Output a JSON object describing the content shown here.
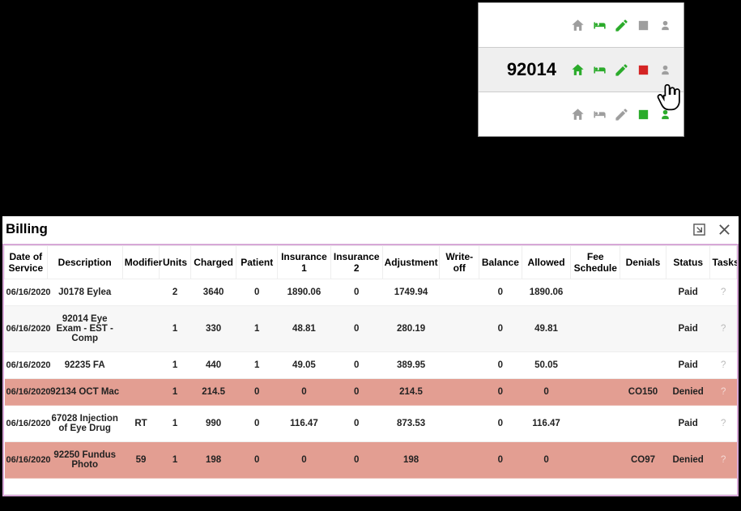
{
  "popup": {
    "rows": [
      {
        "code": ""
      },
      {
        "code": "92014",
        "highlight": true,
        "red_box": true
      },
      {
        "code": ""
      }
    ]
  },
  "billing": {
    "title": "Billing",
    "columns": [
      "Date of Service",
      "Description",
      "Modifier",
      "Units",
      "Charged",
      "Patient",
      "Insurance 1",
      "Insurance 2",
      "Adjustment",
      "Write-off",
      "Balance",
      "Allowed",
      "Fee Schedule",
      "Denials",
      "Status",
      "Tasks"
    ],
    "rows": [
      {
        "dos": "06/16/2020",
        "desc": "J0178 Eylea",
        "mod": "",
        "units": "2",
        "charged": "3640",
        "patient": "0",
        "ins1": "1890.06",
        "ins2": "0",
        "adj": "1749.94",
        "wo": "",
        "bal": "0",
        "allow": "1890.06",
        "fee": "",
        "den": "",
        "status": "Paid",
        "tasks": "?",
        "class": ""
      },
      {
        "dos": "06/16/2020",
        "desc": "92014 Eye Exam - EST - Comp",
        "mod": "",
        "units": "1",
        "charged": "330",
        "patient": "1",
        "ins1": "48.81",
        "ins2": "0",
        "adj": "280.19",
        "wo": "",
        "bal": "0",
        "allow": "49.81",
        "fee": "",
        "den": "",
        "status": "Paid",
        "tasks": "?",
        "class": "alt"
      },
      {
        "dos": "06/16/2020",
        "desc": "92235 FA",
        "mod": "",
        "units": "1",
        "charged": "440",
        "patient": "1",
        "ins1": "49.05",
        "ins2": "0",
        "adj": "389.95",
        "wo": "",
        "bal": "0",
        "allow": "50.05",
        "fee": "",
        "den": "",
        "status": "Paid",
        "tasks": "?",
        "class": ""
      },
      {
        "dos": "06/16/2020",
        "desc": "92134 OCT Mac",
        "mod": "",
        "units": "1",
        "charged": "214.5",
        "patient": "0",
        "ins1": "0",
        "ins2": "0",
        "adj": "214.5",
        "wo": "",
        "bal": "0",
        "allow": "0",
        "fee": "",
        "den": "CO150",
        "status": "Denied",
        "tasks": "?",
        "class": "denied"
      },
      {
        "dos": "06/16/2020",
        "desc": "67028 Injection of Eye Drug",
        "mod": "RT",
        "units": "1",
        "charged": "990",
        "patient": "0",
        "ins1": "116.47",
        "ins2": "0",
        "adj": "873.53",
        "wo": "",
        "bal": "0",
        "allow": "116.47",
        "fee": "",
        "den": "",
        "status": "Paid",
        "tasks": "?",
        "class": ""
      },
      {
        "dos": "06/16/2020",
        "desc": "92250 Fundus Photo",
        "mod": "59",
        "units": "1",
        "charged": "198",
        "patient": "0",
        "ins1": "0",
        "ins2": "0",
        "adj": "198",
        "wo": "",
        "bal": "0",
        "allow": "0",
        "fee": "",
        "den": "CO97",
        "status": "Denied",
        "tasks": "?",
        "class": "denied"
      }
    ]
  },
  "chart_data": {
    "type": "table",
    "title": "Billing",
    "columns": [
      "Date of Service",
      "Description",
      "Modifier",
      "Units",
      "Charged",
      "Patient",
      "Insurance 1",
      "Insurance 2",
      "Adjustment",
      "Write-off",
      "Balance",
      "Allowed",
      "Fee Schedule",
      "Denials",
      "Status"
    ],
    "rows": [
      [
        "06/16/2020",
        "J0178 Eylea",
        "",
        2,
        3640,
        0,
        1890.06,
        0,
        1749.94,
        null,
        0,
        1890.06,
        "",
        "",
        "Paid"
      ],
      [
        "06/16/2020",
        "92014 Eye Exam - EST - Comp",
        "",
        1,
        330,
        1,
        48.81,
        0,
        280.19,
        null,
        0,
        49.81,
        "",
        "",
        "Paid"
      ],
      [
        "06/16/2020",
        "92235 FA",
        "",
        1,
        440,
        1,
        49.05,
        0,
        389.95,
        null,
        0,
        50.05,
        "",
        "",
        "Paid"
      ],
      [
        "06/16/2020",
        "92134 OCT Mac",
        "",
        1,
        214.5,
        0,
        0,
        0,
        214.5,
        null,
        0,
        0,
        "",
        "CO150",
        "Denied"
      ],
      [
        "06/16/2020",
        "67028 Injection of Eye Drug",
        "RT",
        1,
        990,
        0,
        116.47,
        0,
        873.53,
        null,
        0,
        116.47,
        "",
        "",
        "Paid"
      ],
      [
        "06/16/2020",
        "92250 Fundus Photo",
        "59",
        1,
        198,
        0,
        0,
        0,
        198,
        null,
        0,
        0,
        "",
        "CO97",
        "Denied"
      ]
    ]
  }
}
